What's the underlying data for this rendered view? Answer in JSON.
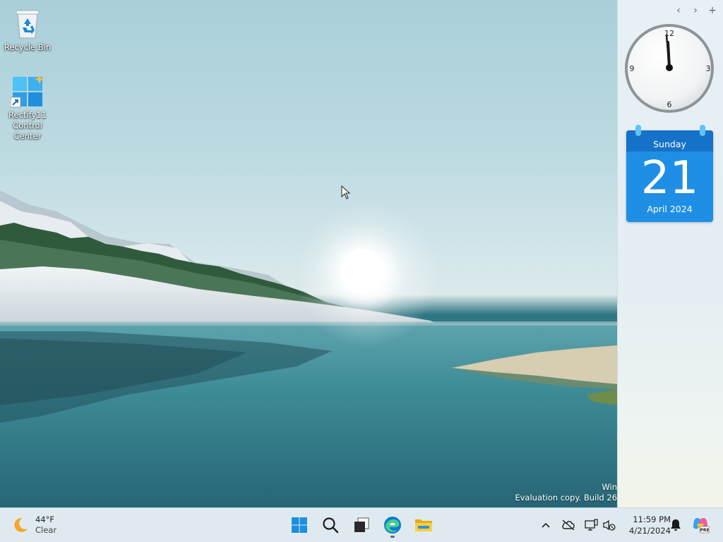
{
  "desktop": {
    "icons": [
      {
        "label": "Recycle Bin",
        "icon": "recycle-bin-icon"
      },
      {
        "label": "Rectify11 Control Center",
        "icon": "rectify11-icon"
      }
    ],
    "watermark": {
      "line1": "Win",
      "line2": "Evaluation copy. Build 26"
    }
  },
  "sidebar": {
    "nav": {
      "prev": "‹",
      "next": "›",
      "add": "+"
    },
    "clock": {
      "numerals": [
        "12",
        "3",
        "6",
        "9"
      ],
      "time": "11:59"
    },
    "calendar": {
      "weekday": "Sunday",
      "day": "21",
      "month_year": "April 2024",
      "accent": "#1e8fe4"
    }
  },
  "taskbar": {
    "weather": {
      "temp": "44°F",
      "condition": "Clear",
      "icon": "moon-icon"
    },
    "pinned": [
      {
        "name": "start",
        "icon": "windows-logo-icon"
      },
      {
        "name": "search",
        "icon": "search-icon"
      },
      {
        "name": "task-view",
        "icon": "task-view-icon"
      },
      {
        "name": "edge",
        "icon": "edge-icon"
      },
      {
        "name": "file-explorer",
        "icon": "folder-icon"
      }
    ],
    "tray": {
      "overflow": "chevron-up-icon",
      "icons": [
        "cloud-offline-icon",
        "network-icon",
        "volume-mute-icon"
      ]
    },
    "clock": {
      "time": "11:59 PM",
      "date": "4/21/2024"
    },
    "notifications_icon": "bell-icon",
    "copilot_badge": "PRE"
  }
}
